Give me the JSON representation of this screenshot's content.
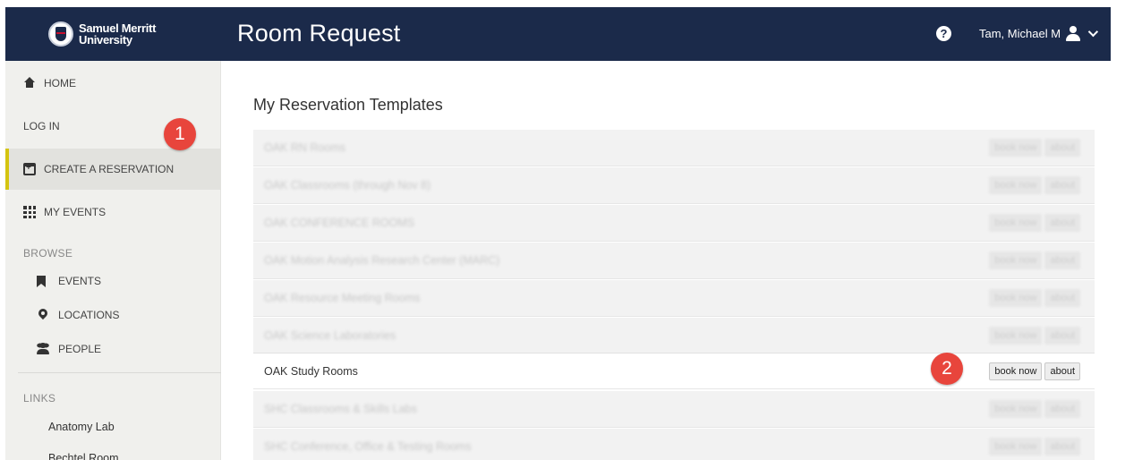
{
  "header": {
    "logo_line1": "Samuel Merritt",
    "logo_line2": "University",
    "title": "Room Request",
    "help_glyph": "?",
    "user_name": "Tam, Michael M",
    "background_color": "#1b2a4a"
  },
  "sidebar": {
    "nav": [
      {
        "label": "HOME",
        "icon": "home-icon"
      },
      {
        "label": "LOG IN",
        "icon": ""
      },
      {
        "label": "CREATE A RESERVATION",
        "icon": "calendar-plus-icon",
        "active": true
      },
      {
        "label": "MY EVENTS",
        "icon": "grid-icon"
      }
    ],
    "browse_label": "BROWSE",
    "browse_items": [
      {
        "label": "EVENTS",
        "icon": "bookmark-icon"
      },
      {
        "label": "LOCATIONS",
        "icon": "map-pin-icon"
      },
      {
        "label": "PEOPLE",
        "icon": "people-icon"
      }
    ],
    "links_label": "LINKS",
    "links": [
      "Anatomy Lab",
      "Bechtel Room"
    ],
    "active_accent_color": "#d4c411"
  },
  "main": {
    "title": "My Reservation Templates",
    "book_label": "book now",
    "about_label": "about",
    "rows": [
      {
        "name": "OAK RN Rooms",
        "blurred": true
      },
      {
        "name": "OAK Classrooms (through Nov 8)",
        "blurred": true
      },
      {
        "name": "OAK CONFERENCE ROOMS",
        "blurred": true
      },
      {
        "name": "OAK Motion Analysis Research Center (MARC)",
        "blurred": true
      },
      {
        "name": "OAK Resource Meeting Rooms",
        "blurred": true
      },
      {
        "name": "OAK Science Laboratories",
        "blurred": true
      },
      {
        "name": "OAK Study Rooms",
        "blurred": false
      },
      {
        "name": "SHC Classrooms & Skills Labs",
        "blurred": true
      },
      {
        "name": "SHC Conference, Office & Testing Rooms",
        "blurred": true
      }
    ]
  },
  "callouts": {
    "one": "1",
    "two": "2",
    "color": "#e8453c"
  }
}
